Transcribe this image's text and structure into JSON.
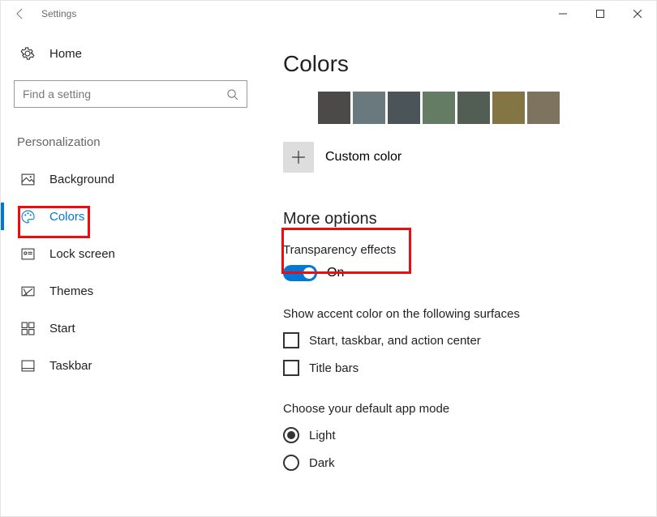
{
  "window": {
    "title": "Settings"
  },
  "sidebar": {
    "home_label": "Home",
    "search_placeholder": "Find a setting",
    "category": "Personalization",
    "items": [
      {
        "label": "Background",
        "icon": "picture"
      },
      {
        "label": "Colors",
        "icon": "palette",
        "selected": true
      },
      {
        "label": "Lock screen",
        "icon": "lockscreen"
      },
      {
        "label": "Themes",
        "icon": "themes"
      },
      {
        "label": "Start",
        "icon": "start"
      },
      {
        "label": "Taskbar",
        "icon": "taskbar"
      }
    ]
  },
  "main": {
    "title": "Colors",
    "swatches": [
      "#767676",
      "#4c4a48",
      "#69797e",
      "#4a5459",
      "#647c64",
      "#525e54",
      "#847545",
      "#7e735f"
    ],
    "custom_label": "Custom color",
    "more_options": "More options",
    "transparency": {
      "label": "Transparency effects",
      "value": "On",
      "on": true
    },
    "accent_surfaces": {
      "label": "Show accent color on the following surfaces",
      "options": [
        {
          "label": "Start, taskbar, and action center",
          "checked": false
        },
        {
          "label": "Title bars",
          "checked": false
        }
      ]
    },
    "app_mode": {
      "label": "Choose your default app mode",
      "options": [
        {
          "label": "Light",
          "selected": true
        },
        {
          "label": "Dark",
          "selected": false
        }
      ]
    }
  }
}
